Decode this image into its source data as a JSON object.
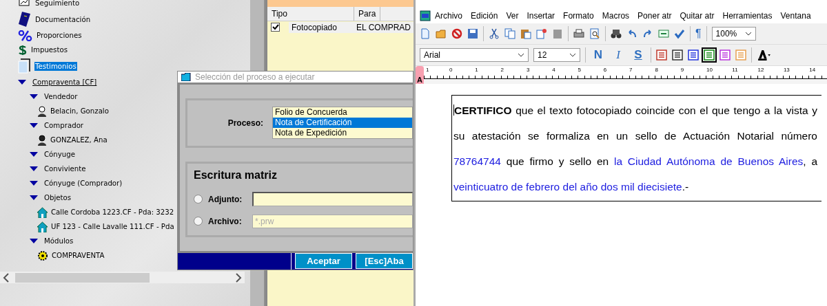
{
  "tree": {
    "items": [
      {
        "label": "Seguimiento",
        "kind": "chart",
        "selected": false
      },
      {
        "label": "Documentación",
        "kind": "book",
        "selected": false
      },
      {
        "label": "Proporciones",
        "kind": "percent",
        "selected": false
      },
      {
        "label": "Impuestos",
        "kind": "money",
        "selected": false
      },
      {
        "label": "Testimonios",
        "kind": "pages",
        "selected": true
      },
      {
        "label": "Compraventa [CF]",
        "kind": "section",
        "expanded": true,
        "selected": false,
        "children": [
          {
            "label": "Vendedor",
            "kind": "group",
            "expanded": true,
            "selected": false,
            "children": [
              {
                "label": "Belacin, Gonzalo",
                "kind": "man",
                "selected": false
              }
            ]
          },
          {
            "label": "Comprador",
            "kind": "group",
            "expanded": true,
            "selected": false,
            "children": [
              {
                "label": "GONZALEZ, Ana",
                "kind": "woman",
                "selected": false
              }
            ]
          },
          {
            "label": "Cónyuge",
            "kind": "group",
            "expanded": true,
            "selected": false
          },
          {
            "label": "Conviviente",
            "kind": "group",
            "expanded": true,
            "selected": false
          },
          {
            "label": "Cónyuge (Comprador)",
            "kind": "group",
            "expanded": true,
            "selected": false
          },
          {
            "label": "Objetos",
            "kind": "group",
            "expanded": true,
            "selected": false,
            "children": [
              {
                "label": "Calle Cordoba 1223.CF - Pda: 3232",
                "kind": "house",
                "selected": false
              },
              {
                "label": "UF 123 - Calle Lavalle 111.CF - Pda",
                "kind": "house",
                "selected": false
              }
            ]
          },
          {
            "label": "Módulos",
            "kind": "group",
            "expanded": true,
            "selected": false,
            "children": [
              {
                "label": "COMPRAVENTA",
                "kind": "gear",
                "selected": false
              }
            ]
          }
        ]
      }
    ]
  },
  "records": {
    "columns": [
      "Tipo",
      "Para"
    ],
    "rows": [
      {
        "checked": true,
        "tipo": "Fotocopiado",
        "para": "EL COMPRAD"
      }
    ]
  },
  "dialog": {
    "title": "Selección del proceso a ejecutar",
    "proceso_label": "Proceso:",
    "options": [
      {
        "label": "Folio de Concuerda",
        "selected": false
      },
      {
        "label": "Nota de Certificación",
        "selected": true
      },
      {
        "label": "Nota de Expedición",
        "selected": false
      }
    ],
    "section_title": "Escritura matriz",
    "fields": [
      {
        "label": "Adjunto:",
        "checked": false
      },
      {
        "label": "Archivo:",
        "checked": false,
        "placeholder": "*.prw"
      }
    ],
    "buttons": [
      "Aceptar",
      "[Esc]Aba"
    ]
  },
  "editor": {
    "menu": [
      "Archivo",
      "Edición",
      "Ver",
      "Insertar",
      "Formato",
      "Macros",
      "Poner atr",
      "Quitar atr",
      "Herramientas",
      "Ventana"
    ],
    "pilcrow": "¶",
    "zoom": "100%",
    "font": "Arial",
    "size": "12",
    "styles": [
      "N",
      "I",
      "S"
    ],
    "ruler": [
      "1",
      "0",
      "1",
      "2",
      "3",
      "4",
      "5",
      "6",
      "7",
      "8",
      "9",
      "10",
      "11",
      "12",
      "13",
      "14"
    ],
    "side_tab": "A",
    "paragraph": [
      {
        "kind": "bold",
        "text": "CERTIFICO"
      },
      {
        "kind": "plain",
        "text": " que el texto fotocopiado coincide con el que tengo a la vista y su atestación se formaliza en un sello de Actuación Notarial número "
      },
      {
        "kind": "field",
        "text": "78764744"
      },
      {
        "kind": "plain",
        "text": " que firmo y sello en "
      },
      {
        "kind": "field",
        "text": "la Ciudad Autónoma de Buenos Aires"
      },
      {
        "kind": "plain",
        "text": ", a "
      },
      {
        "kind": "field",
        "text": "veinticuatro de febrero del año dos mil diecisiete"
      },
      {
        "kind": "plain",
        "text": ".-"
      }
    ]
  }
}
